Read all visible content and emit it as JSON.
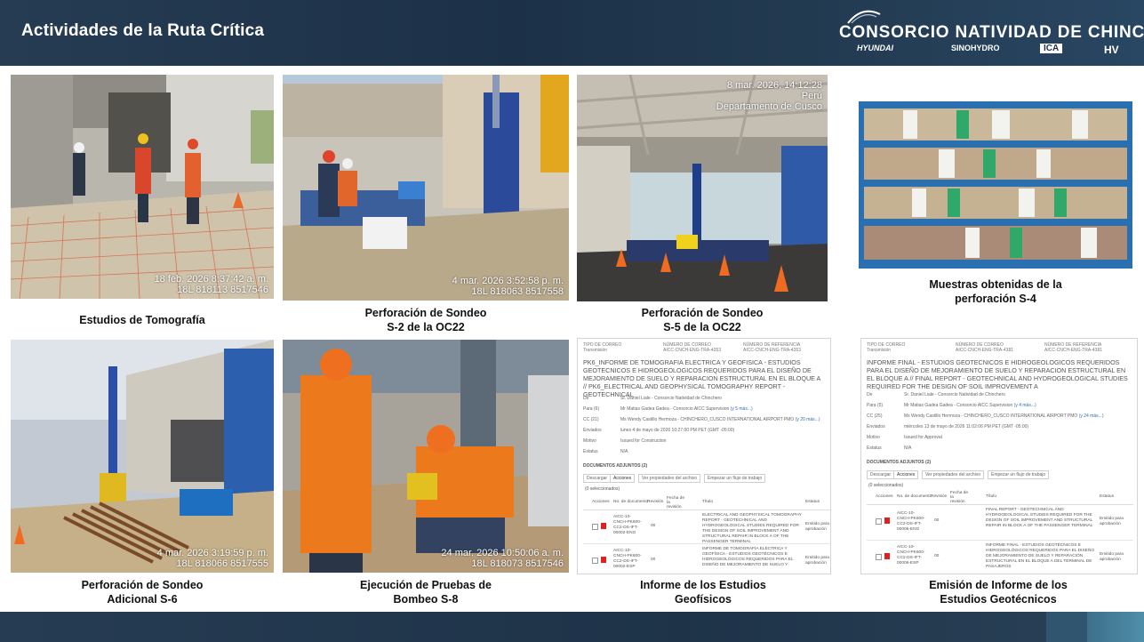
{
  "header": {
    "title": "Actividades de la Ruta Crítica",
    "logo": {
      "main": "CONSORCIO NATIVIDAD DE CHINCHERO",
      "partners": [
        "HYUNDAI",
        "SINOHYDRO",
        "ICA",
        "HV"
      ]
    }
  },
  "colors": {
    "header_bg": "#1c3147",
    "footer_accent": "#4f8ea9",
    "caption_text": "#111111"
  },
  "photos": [
    {
      "caption": [
        "Estudios de Tomografía"
      ],
      "stamp": [
        "18 feb. 2026 8:37:42 a. m.",
        "18L 818113 8517546"
      ]
    },
    {
      "caption": [
        "Perforación de Sondeo",
        "S-2 de la OC22"
      ],
      "stamp": [
        "4 mar. 2026 3:52:58 p. m.",
        "18L 818063 8517558"
      ]
    },
    {
      "caption": [
        "Perforación de Sondeo",
        "S-5 de la OC22"
      ],
      "stamp": [
        "8 mar. 2026, 14:12:28",
        "Perú",
        "Departamento de Cusco"
      ]
    },
    {
      "caption": [
        "Muestras obtenidas de la",
        "perforación S-4"
      ],
      "stamp": []
    },
    {
      "caption": [
        "Perforación de Sondeo",
        "Adicional S-6"
      ],
      "stamp": [
        "4 mar. 2026 3:19:59 p. m.",
        "18L 818066 8517555"
      ]
    },
    {
      "caption": [
        "Ejecución de Pruebas de",
        "Bombeo S-8"
      ],
      "stamp": [
        "24 mar. 2026 10:50:06 a. m.",
        "18L 818073 8517546"
      ]
    }
  ],
  "documents": [
    {
      "caption": [
        "Informe de los Estudios",
        "Geofísicos"
      ],
      "top": {
        "c1": "TIPO DE CORREO",
        "c1v": "Transmisión",
        "c2": "NÚMERO DE CORREO",
        "c2v": "AICC-CNCH-ENG-TRA-4353",
        "c3": "NÚMERO DE REFERENCIA",
        "c3v": "AICC-CNCH-ENG-TRA-4353"
      },
      "subject": "PK6_INFORME DE TOMOGRAFIA ELECTRICA Y GEOFISICA - ESTUDIOS GEOTECNICOS E HIDROGEOLOGICOS REQUERIDOS PARA EL DISEÑO DE MEJORAMIENTO DE SUELO Y REPARACION ESTRUCTURAL EN EL BLOQUE A // PK6_ELECTRICAL AND GEOPHYSICAL TOMOGRAPHY REPORT - GEOTECHNICAL",
      "meta": [
        {
          "k": "De",
          "v": "Sr. Daniel Liale - Consorcio Natividad de Chinchero",
          "l": ""
        },
        {
          "k": "Para (6)",
          "v": "Mr Matias Gadea Gadea - Consorcio AICC Supervision",
          "l": "(y 5 más...)"
        },
        {
          "k": "CC (21)",
          "v": "Ms Wendy Castillo Hermoza - CHINCHERO_CUSCO INTERNATIONAL AIRPORT PMO",
          "l": "(y 20 más...)"
        },
        {
          "k": "Enviados",
          "v": "lunes 4 de mayo de 2026 10:27:00 PM PET (GMT -05:00)",
          "l": ""
        },
        {
          "k": "Motivo",
          "v": "Issued for Construction",
          "l": ""
        },
        {
          "k": "Estatus",
          "v": "N/A",
          "l": ""
        }
      ],
      "attachments": "DOCUMENTOS ADJUNTOS (2)",
      "toolbar": [
        "Descargar",
        "Acciones",
        "Ver propiedades del archivo",
        "Empezar un flujo de trabajo"
      ],
      "selected": "(0 seleccionados)",
      "columns": [
        "Acciones",
        "No. de documento",
        "Revisión",
        "Fecha de la revisión",
        "Título",
        "Estatus"
      ],
      "rows": [
        {
          "doc": "AICC-10-CNCH-PK600-CC2-DS-IFT-00002-ENG",
          "rev": "00",
          "title": "ELECTRICAL AND GEOPHYSICAL TOMOGRAPHY REPORT - GEOTECHNICAL AND HYDROGEOLOGICAL STUDIES REQUIRED FOR THE DESIGN OF SOIL IMPROVEMENT AND STRUCTURAL REPAIR IN BLOCK A OF THE PASSENGER TERMINAL",
          "status": "Emitido para aprobación"
        },
        {
          "doc": "AICC-10-CNCH-PK600-CC2-DS-IFT-00002-ESP",
          "rev": "00",
          "title": "INFORME DE TOMOGRAFÍA ELÉCTRICA Y GEOFÍSICA - ESTUDIOS GEOTÉCNICOS E HIDROGEOLÓGICOS REQUERIDOS PARA EL DISEÑO DE MEJORAMIENTO DE SUELO Y",
          "status": "Emitido para aprobación"
        }
      ]
    },
    {
      "caption": [
        "Emisión de Informe de los",
        "Estudios Geotécnicos"
      ],
      "top": {
        "c1": "TIPO DE CORREO",
        "c1v": "Transmisión",
        "c2": "NÚMERO DE CORREO",
        "c2v": "AICC-CNCH-ENG-TRA-4381",
        "c3": "NÚMERO DE REFERENCIA",
        "c3v": "AICC-CNCH-ENG-TRA-4381"
      },
      "subject": "INFORME FINAL - ESTUDIOS GEOTECNICOS E HIDROGEOLOGICOS REQUERIDOS PARA EL DISEÑO DE MEJORAMIENTO DE SUELO Y REPARACION ESTRUCTURAL EN EL BLOQUE A // FINAL REPORT - GEOTECHNICAL AND HYDROGEOLOGICAL STUDIES REQUIRED FOR THE DESIGN OF SOIL IMPROVEMENT A",
      "meta": [
        {
          "k": "De",
          "v": "Sr. Daniel Liale - Consorcio Natividad de Chinchero",
          "l": ""
        },
        {
          "k": "Para (5)",
          "v": "Mr Matias Gadea Gadea - Consorcio AICC Supervision",
          "l": "(y 4 más...)"
        },
        {
          "k": "CC (25)",
          "v": "Ms Wendy Castillo Hermoza - CHINCHERO_CUSCO INTERNATIONAL AIRPORT PMO",
          "l": "(y 24 más...)"
        },
        {
          "k": "Enviados",
          "v": "miércoles 13 de mayo de 2026 11:02:06 PM PET (GMT -05:00)",
          "l": ""
        },
        {
          "k": "Motivo",
          "v": "Issued for Approval",
          "l": ""
        },
        {
          "k": "Estatus",
          "v": "N/A",
          "l": ""
        }
      ],
      "attachments": "DOCUMENTOS ADJUNTOS (2)",
      "toolbar": [
        "Descargar",
        "Acciones",
        "Ver propiedades del archivo",
        "Empezar un flujo de trabajo"
      ],
      "selected": "(0 seleccionados)",
      "columns": [
        "Acciones",
        "No. de documento",
        "Revisión",
        "Fecha de la revisión",
        "Título",
        "Estatus"
      ],
      "rows": [
        {
          "doc": "AICC-10-CNCH-PK600-CC2-DS-IFT-00006-ENG",
          "rev": "00",
          "title": "FINAL REPORT - GEOTECHNICAL AND HYDROGEOLOGICAL STUDIES REQUIRED FOR THE DESIGN OF SOIL IMPROVEMENT AND STRUCTURAL REPAIR IN BLOCK A OF THE PASSENGER TERMINAL",
          "status": "Emitido para aprobación"
        },
        {
          "doc": "AICC-10-CNCH-PK600-CC2-DS-IFT-00006-ESP",
          "rev": "00",
          "title": "INFORME FINAL - ESTUDIOS GEOTÉCNICOS E HIDROGEOLÓGICOS REQUERIDOS PARA EL DISEÑO DE MEJORAMIENTO DE SUELO Y REPARACIÓN ESTRUCTURAL EN EL BLOQUE A DEL TERMINAL DE PASAJEROS",
          "status": "Emitido para aprobación"
        }
      ]
    }
  ]
}
